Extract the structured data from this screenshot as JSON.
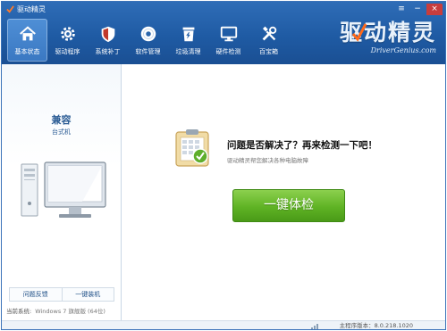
{
  "window": {
    "title": "驱动精灵",
    "controls": {
      "menu": "≡",
      "minimize": "−",
      "close": "×"
    }
  },
  "nav": {
    "items": [
      {
        "label": "基本状态",
        "icon": "home-icon",
        "active": true
      },
      {
        "label": "驱动程序",
        "icon": "gear-icon",
        "active": false
      },
      {
        "label": "系统补丁",
        "icon": "shield-icon",
        "active": false
      },
      {
        "label": "软件管理",
        "icon": "disc-icon",
        "active": false
      },
      {
        "label": "垃圾清理",
        "icon": "trash-icon",
        "active": false
      },
      {
        "label": "硬件检测",
        "icon": "monitor-icon",
        "active": false
      },
      {
        "label": "百宝箱",
        "icon": "tools-icon",
        "active": false
      }
    ]
  },
  "brand": {
    "name_cn": "驱动精灵",
    "name_en": "DriverGenius.com"
  },
  "left": {
    "machine_name": "兼容",
    "machine_type": "台式机",
    "buttons": {
      "feedback": "问题反馈",
      "install": "一键装机"
    },
    "os_label": "当前系统:",
    "os_value": "Windows 7 旗舰版 (64位)"
  },
  "main": {
    "question": "问题是否解决了？再来检测一下吧！",
    "subtext": "驱动精灵帮您解决各种电脑故障",
    "check_button": "一键体检"
  },
  "statusbar": {
    "version_label": "主程序版本：",
    "version_value": "8.0.218.1020"
  },
  "colors": {
    "header": "#1f5ba4",
    "accent_green": "#5fb324",
    "text_blue": "#2a5b94"
  }
}
